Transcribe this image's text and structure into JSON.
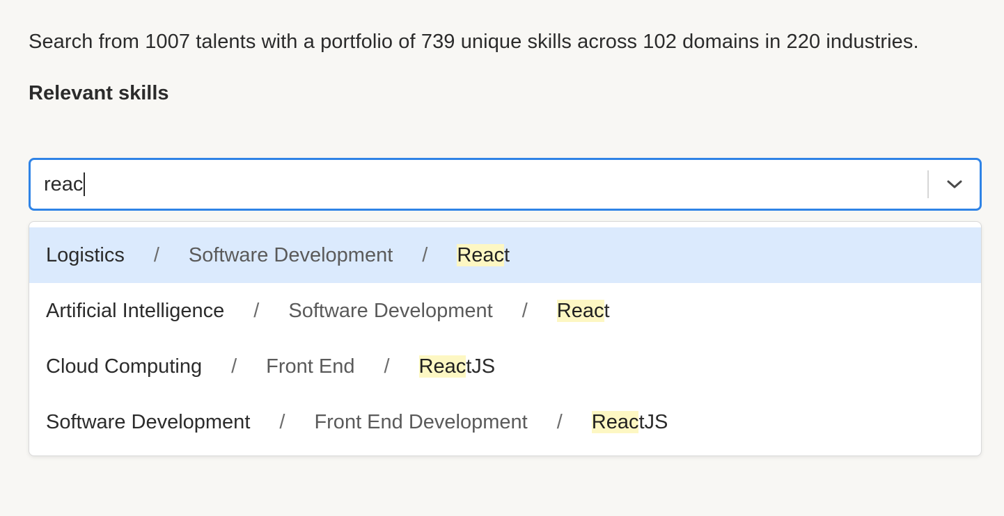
{
  "intro": {
    "text": "Search from 1007 talents with a portfolio of 739 unique skills across 102 domains in 220 industries."
  },
  "skills_field": {
    "label": "Relevant skills",
    "value": "reac",
    "chevron_icon": "chevron-down-icon"
  },
  "colors": {
    "focus_border": "#2f83e6",
    "active_option_bg": "#dbeafd",
    "highlight_bg": "#fdf7c3",
    "page_bg": "#f8f7f4"
  },
  "options": [
    {
      "industry": "Logistics",
      "domain": "Software Development",
      "skill_match": "Reac",
      "skill_rest": "t",
      "active": true
    },
    {
      "industry": "Artificial Intelligence",
      "domain": "Software Development",
      "skill_match": "Reac",
      "skill_rest": "t",
      "active": false
    },
    {
      "industry": "Cloud Computing",
      "domain": "Front End",
      "skill_match": "Reac",
      "skill_rest": "tJS",
      "active": false
    },
    {
      "industry": "Software Development",
      "domain": "Front End Development",
      "skill_match": "Reac",
      "skill_rest": "tJS",
      "active": false
    }
  ],
  "separator_glyph": "/"
}
